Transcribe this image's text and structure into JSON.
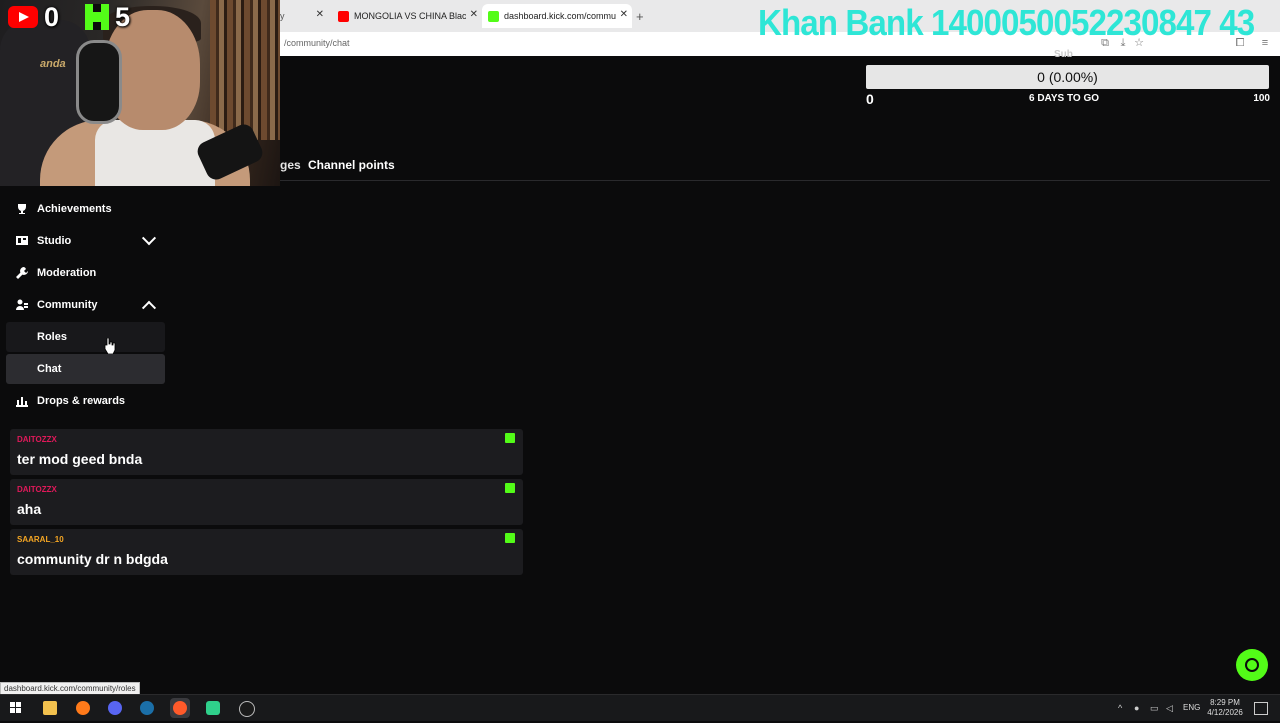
{
  "browser": {
    "tabs": [
      {
        "label": "y",
        "active": false
      },
      {
        "label": "MONGOLIA VS CHINA Black co",
        "active": false
      },
      {
        "label": "dashboard.kick.com/communit",
        "active": true
      }
    ],
    "new_tab": "+",
    "address": "/community/chat"
  },
  "overlay": {
    "youtube_count": "0",
    "kick_count": "5",
    "banner": "Khan Bank 1400050052230847 43"
  },
  "goal": {
    "label": "Sub",
    "progress_text": "0 (0.00%)",
    "progress_fraction": 0.0,
    "min": "0",
    "days_to_go": "6 DAYS TO GO",
    "max": "100"
  },
  "page_tabs": {
    "partial": "ges",
    "channel_points": "Channel points"
  },
  "sidebar": {
    "items": [
      {
        "label": "Achievements",
        "icon": "trophy-icon"
      },
      {
        "label": "Studio",
        "icon": "studio-icon"
      },
      {
        "label": "Moderation",
        "icon": "wrench-icon"
      },
      {
        "label": "Community",
        "icon": "community-icon"
      },
      {
        "label": "Roles"
      },
      {
        "label": "Chat"
      },
      {
        "label": "Drops & rewards",
        "icon": "rewards-icon"
      }
    ]
  },
  "chat": {
    "messages": [
      {
        "user": "DAITOZZX",
        "text": "ter mod geed bnda",
        "user_color": "#e0195a"
      },
      {
        "user": "DAITOZZX",
        "text": "aha",
        "user_color": "#e0195a"
      },
      {
        "user": "SAARAL_10",
        "text": "community dr n bdgda",
        "user_color": "#f5a623"
      }
    ]
  },
  "status_url": "dashboard.kick.com/community/roles",
  "taskbar": {
    "lang": "ENG",
    "time": "8:29 PM",
    "date": "4/12/2026"
  },
  "colors": {
    "kick_green": "#53fc18",
    "banner_cyan": "#2ee6d6",
    "background": "#0b0b0c"
  }
}
